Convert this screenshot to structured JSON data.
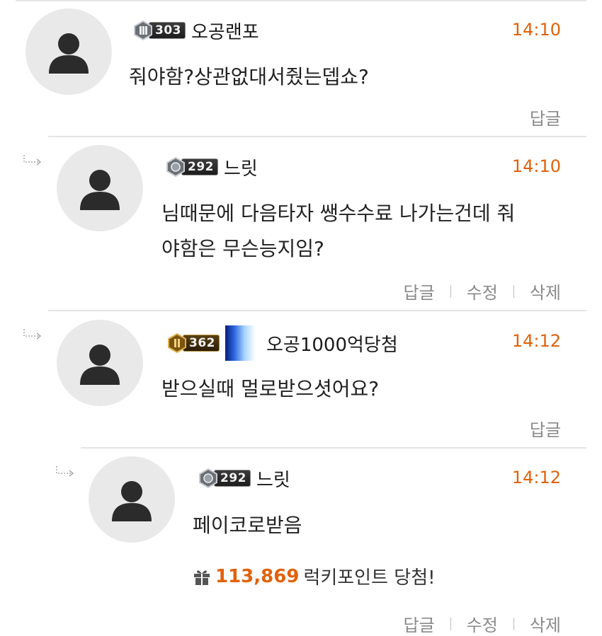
{
  "comments": [
    {
      "level": "303",
      "nickname": "오공랜포",
      "time": "14:10",
      "text": "줘야함?상관없대서줬는뎁쇼?",
      "actions": [
        "답글"
      ]
    },
    {
      "level": "292",
      "nickname": "느릿",
      "time": "14:10",
      "text_lines": [
        "님때문에 다음타자 쌩수수료 나가는건데 줘",
        "야함은 무슨능지임?"
      ],
      "actions": [
        "답글",
        "수정",
        "삭제"
      ]
    },
    {
      "level": "362",
      "nickname": "오공1000억당첨",
      "time": "14:12",
      "text": "받으실때 멀로받으셧어요?",
      "actions": [
        "답글"
      ]
    },
    {
      "level": "292",
      "nickname": "느릿",
      "time": "14:12",
      "text": "페이코로받음",
      "lucky_points": "113,869",
      "lucky_text": "럭키포인트 당첨!",
      "actions": [
        "답글",
        "수정",
        "삭제"
      ]
    }
  ],
  "colors": {
    "accent_orange": "#e2610a",
    "action_gray": "#8a8a8a",
    "avatar_bg": "#e9e9e9",
    "avatar_fg": "#2b2b2b"
  },
  "icons": {
    "avatar": "person-silhouette-icon",
    "reply_indent": "reply-arrow-icon",
    "gift": "gift-icon",
    "rank_emblem": "rank-emblem-icon"
  }
}
